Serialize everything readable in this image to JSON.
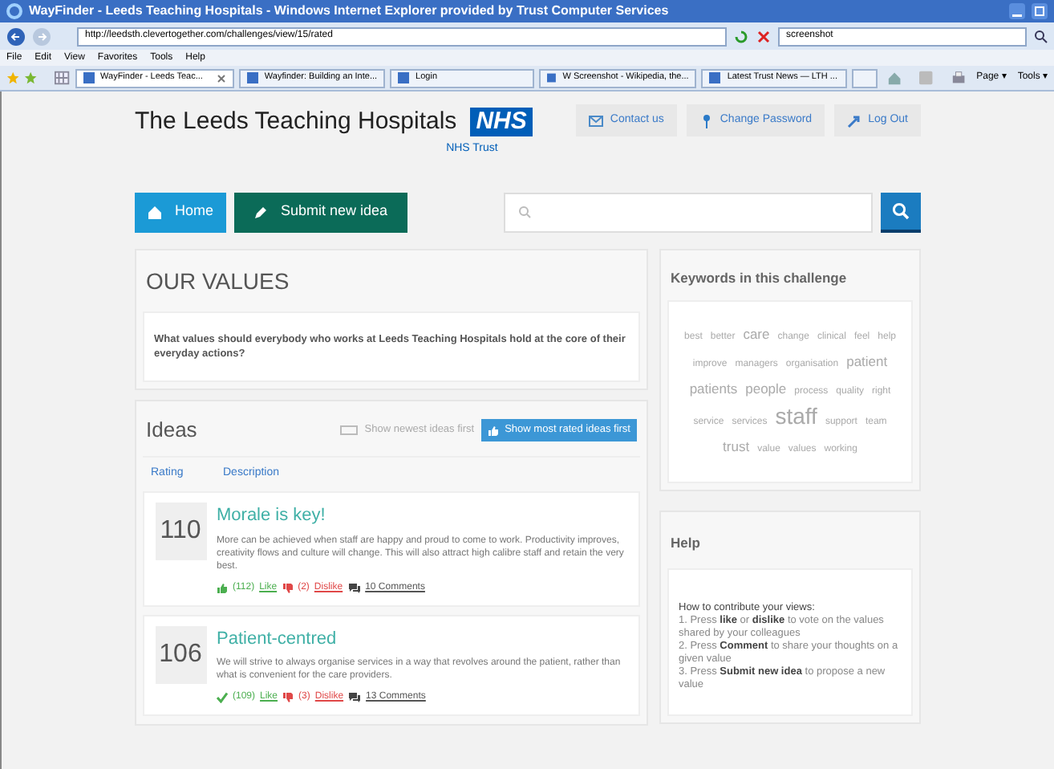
{
  "window": {
    "title": "WayFinder - Leeds Teaching Hospitals - Windows Internet Explorer provided by Trust Computer Services"
  },
  "address_bar": {
    "url": "http://leedsth.clevertogether.com/challenges/view/15/rated",
    "search_value": "screenshot"
  },
  "menu": [
    "File",
    "Edit",
    "View",
    "Favorites",
    "Tools",
    "Help"
  ],
  "browser_tabs": [
    {
      "label": "WayFinder - Leeds Teac...",
      "selected": true
    },
    {
      "label": "Wayfinder: Building an Inte...",
      "selected": false
    },
    {
      "label": "Login",
      "selected": false
    },
    {
      "label": "W Screenshot - Wikipedia, the...",
      "selected": false
    },
    {
      "label": "Latest Trust News — LTH ...",
      "selected": false
    }
  ],
  "command_bar": [
    "Page ▾",
    "Tools ▾"
  ],
  "header": {
    "org": "The Leeds Teaching Hospitals",
    "logo": "NHS",
    "sub": "NHS Trust",
    "links": [
      "Contact us",
      "Change Password",
      "Log Out"
    ]
  },
  "nav": {
    "home": "Home",
    "submit": "Submit new idea"
  },
  "challenge": {
    "title": "OUR VALUES",
    "question": "What values should everybody who works at Leeds Teaching Hospitals hold at the core of their everyday actions?"
  },
  "ideas": {
    "title": "Ideas",
    "sort": [
      {
        "label": "Show newest ideas first",
        "selected": false
      },
      {
        "label": "Show most rated ideas first",
        "selected": true
      }
    ],
    "columns": [
      "Rating",
      "Description"
    ],
    "rows": [
      {
        "rating": "110",
        "title": "Morale is key!",
        "text": "More can be achieved when staff are happy and proud to come to work. Productivity improves, creativity flows and culture will change. This will also attract high calibre staff and retain the very best.",
        "likes": "(112)",
        "like": "Like",
        "liked": false,
        "dislikes": "(2)",
        "dislike": "Dislike",
        "comments": "10 Comments"
      },
      {
        "rating": "106",
        "title": "Patient-centred",
        "text": "We will strive to always organise services in a way that revolves around the patient, rather than what is convenient for the care providers.",
        "likes": "(109)",
        "like": "Like",
        "liked": true,
        "dislikes": "(3)",
        "dislike": "Dislike",
        "comments": "13 Comments"
      }
    ]
  },
  "keywords": {
    "title": "Keywords in this challenge",
    "words": [
      {
        "text": "best",
        "kind": "small"
      },
      {
        "text": "better",
        "kind": "small"
      },
      {
        "text": "care",
        "kind": "medium"
      },
      {
        "text": "change",
        "kind": "small"
      },
      {
        "text": "clinical",
        "kind": "small"
      },
      {
        "text": "feel",
        "kind": "small"
      },
      {
        "text": "help",
        "kind": "small"
      },
      {
        "text": "improve",
        "kind": "small"
      },
      {
        "text": "managers",
        "kind": "small"
      },
      {
        "text": "organisation",
        "kind": "small"
      },
      {
        "text": "patient",
        "kind": "medium"
      },
      {
        "text": "patients",
        "kind": "medium"
      },
      {
        "text": "people",
        "kind": "medium"
      },
      {
        "text": "process",
        "kind": "small"
      },
      {
        "text": "quality",
        "kind": "small"
      },
      {
        "text": "right",
        "kind": "small"
      },
      {
        "text": "service",
        "kind": "small"
      },
      {
        "text": "services",
        "kind": "small"
      },
      {
        "text": "staff",
        "kind": "large"
      },
      {
        "text": "support",
        "kind": "small"
      },
      {
        "text": "team",
        "kind": "small"
      },
      {
        "text": "trust",
        "kind": "medium"
      },
      {
        "text": "value",
        "kind": "small"
      },
      {
        "text": "values",
        "kind": "small"
      },
      {
        "text": "working",
        "kind": "small"
      }
    ]
  },
  "help": {
    "title": "Help",
    "heading": "How to contribute your views:",
    "steps": [
      "1. Press **like** or **dislike** to vote on the values shared by your colleagues",
      "2. Press **Comment** to share your thoughts on a given value",
      "3. Press **Submit new idea** to propose a new value"
    ]
  }
}
